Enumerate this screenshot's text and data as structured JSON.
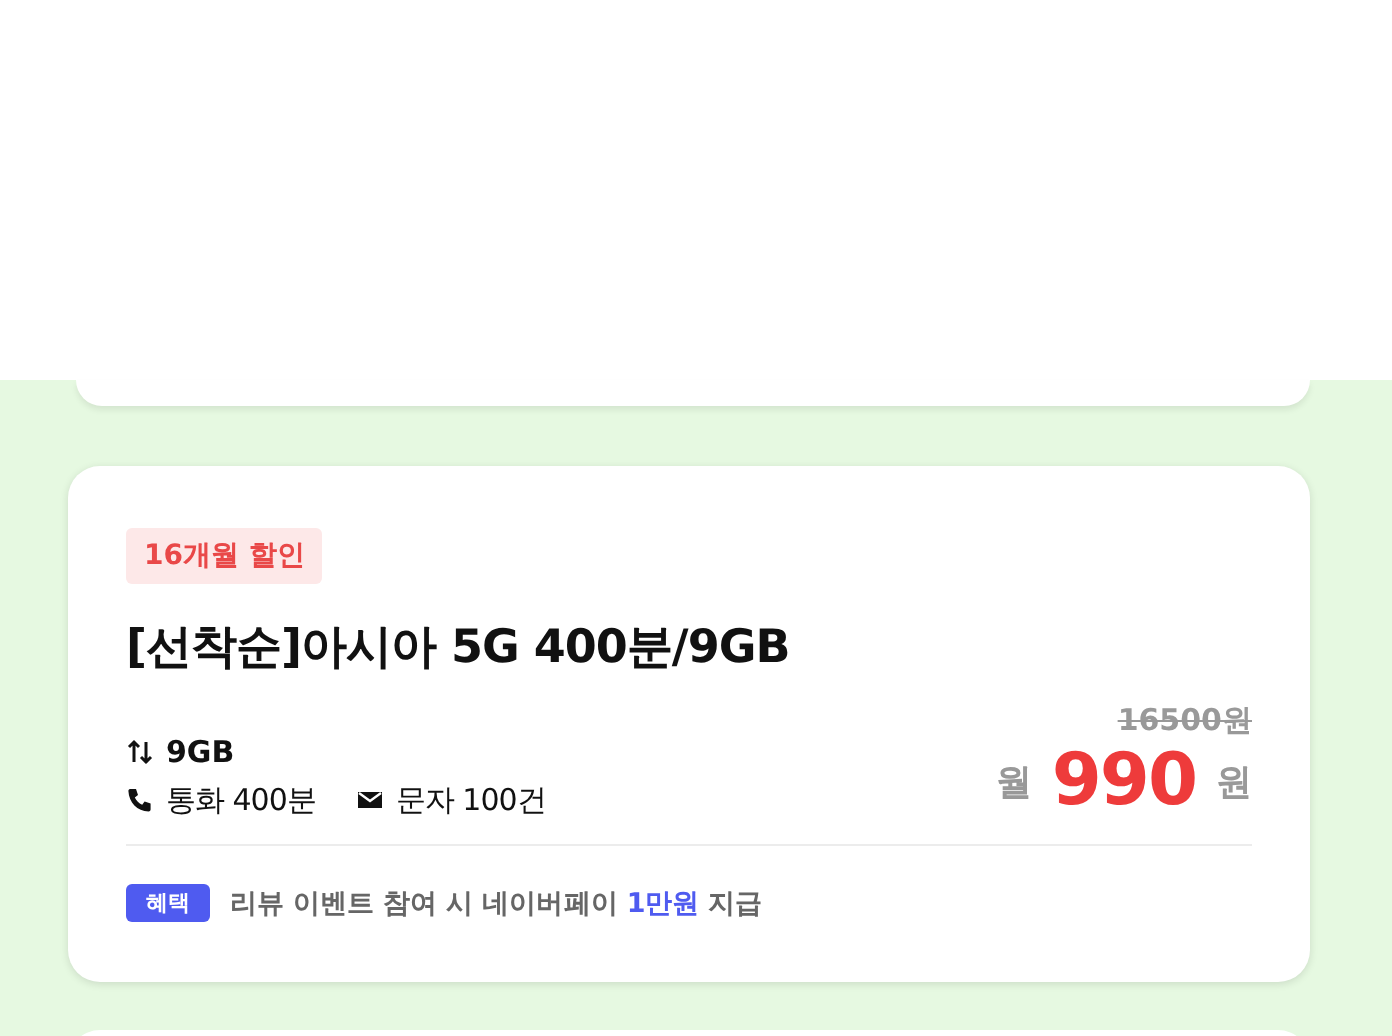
{
  "plan_card": {
    "badge": "16개월 할인",
    "title": "[선착순]아시아 5G 400분/9GB",
    "data": "9GB",
    "call": "통화 400분",
    "sms": "문자 100건",
    "original_price": "16500원",
    "price_prefix": "월",
    "price": "990",
    "price_unit": "원",
    "benefit_tag": "혜택",
    "benefit_text": "리뷰 이벤트 참여 시 네이버페이 **1만원** 지급"
  }
}
